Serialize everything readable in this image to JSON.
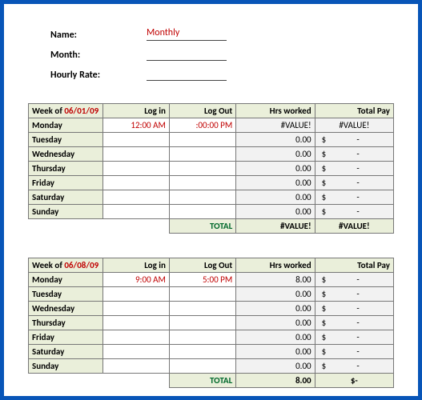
{
  "header": {
    "name_label": "Name:",
    "name_value": "Monthly",
    "month_label": "Month:",
    "month_value": "",
    "rate_label": "Hourly Rate:",
    "rate_value": ""
  },
  "columns": {
    "week_prefix": "Week of ",
    "login": "Log in",
    "logout": "Log Out",
    "hrs": "Hrs worked",
    "pay": "Total Pay",
    "total": "TOTAL"
  },
  "week1": {
    "date": "06/01/09",
    "rows": [
      {
        "day": "Monday",
        "login": "12:00 AM",
        "logout": ":00:00 PM",
        "hrs": "#VALUE!",
        "pay": "#VALUE!"
      },
      {
        "day": "Tuesday",
        "login": "",
        "logout": "",
        "hrs": "0.00",
        "pay": "$-"
      },
      {
        "day": "Wednesday",
        "login": "",
        "logout": "",
        "hrs": "0.00",
        "pay": "$-"
      },
      {
        "day": "Thursday",
        "login": "",
        "logout": "",
        "hrs": "0.00",
        "pay": "$-"
      },
      {
        "day": "Friday",
        "login": "",
        "logout": "",
        "hrs": "0.00",
        "pay": "$-"
      },
      {
        "day": "Saturday",
        "login": "",
        "logout": "",
        "hrs": "0.00",
        "pay": "$-"
      },
      {
        "day": "Sunday",
        "login": "",
        "logout": "",
        "hrs": "0.00",
        "pay": "$-"
      }
    ],
    "total_hrs": "#VALUE!",
    "total_pay": "#VALUE!"
  },
  "week2": {
    "date": "06/08/09",
    "rows": [
      {
        "day": "Monday",
        "login": "9:00 AM",
        "logout": "5:00 PM",
        "hrs": "8.00",
        "pay": "$-"
      },
      {
        "day": "Tuesday",
        "login": "",
        "logout": "",
        "hrs": "0.00",
        "pay": "$-"
      },
      {
        "day": "Wednesday",
        "login": "",
        "logout": "",
        "hrs": "0.00",
        "pay": "$-"
      },
      {
        "day": "Thursday",
        "login": "",
        "logout": "",
        "hrs": "0.00",
        "pay": "$-"
      },
      {
        "day": "Friday",
        "login": "",
        "logout": "",
        "hrs": "0.00",
        "pay": "$-"
      },
      {
        "day": "Saturday",
        "login": "",
        "logout": "",
        "hrs": "0.00",
        "pay": "$-"
      },
      {
        "day": "Sunday",
        "login": "",
        "logout": "",
        "hrs": "0.00",
        "pay": "$-"
      }
    ],
    "total_hrs": "8.00",
    "total_pay": "$-"
  }
}
